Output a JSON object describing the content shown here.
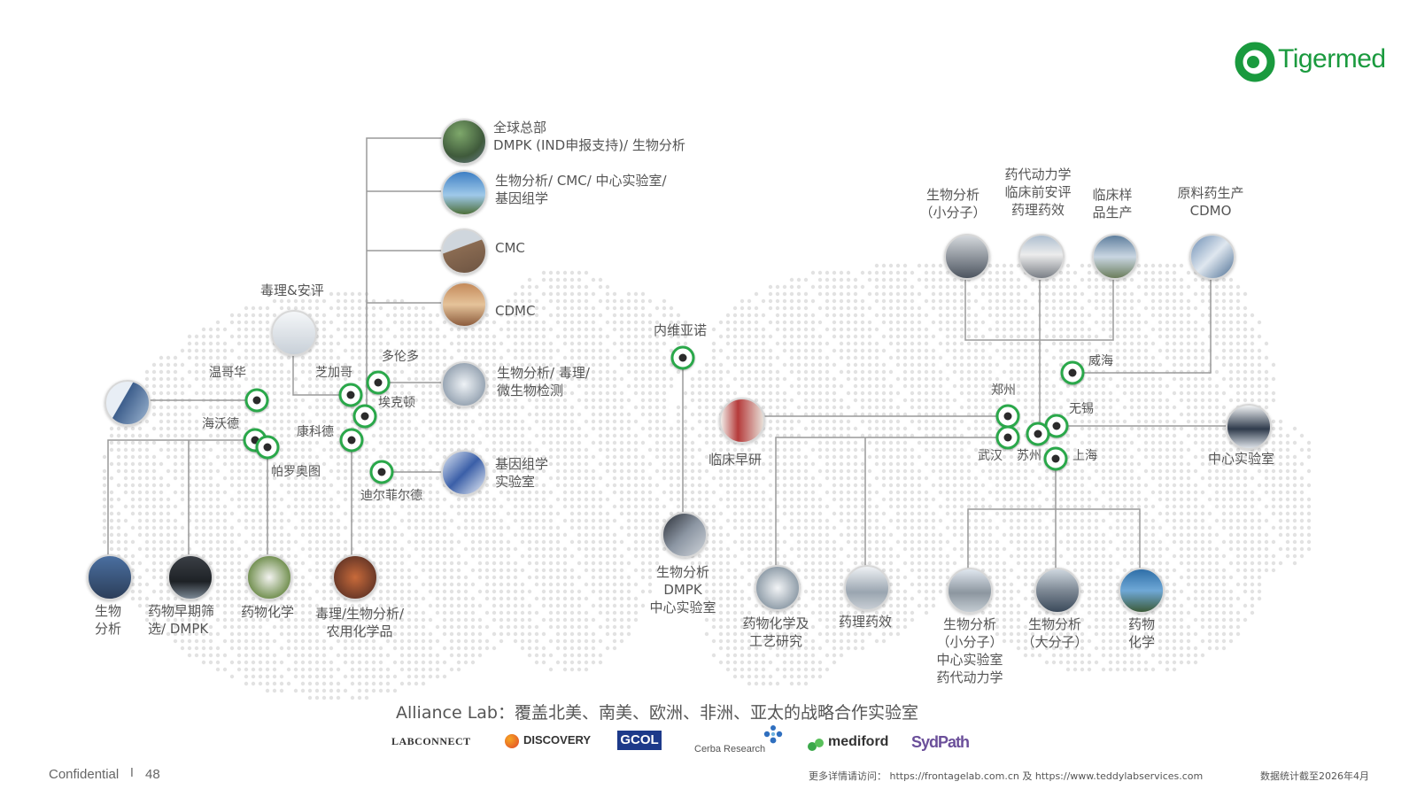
{
  "brand": {
    "name": "Tigermed",
    "color": "#1a9a3e"
  },
  "colors": {
    "node_ring": "#2aa84a",
    "line": "#9a9a9a",
    "dots": "#e2e2e2"
  },
  "north_america": {
    "hq_label": "全球总部",
    "hq_sub": "DMPK (IND申报支持)/ 生物分析",
    "site2": "生物分析/ CMC/ 中心实验室/",
    "site2b": "基因组学",
    "site3": "CMC",
    "site4": "CDMC",
    "site5": "生物分析/ 毒理/",
    "site5b": "微生物检测",
    "site6": "基因组学",
    "site6b": "实验室",
    "tox": "毒理&安评",
    "cities": {
      "vancouver": "温哥华",
      "chicago": "芝加哥",
      "toronto": "多伦多",
      "exton": "埃克顿",
      "hayward": "海沃德",
      "palo_alto": "帕罗奥图",
      "concord": "康科德",
      "deerfield": "迪尔菲尔德"
    },
    "bottom": [
      {
        "l1": "生物",
        "l2": "分析"
      },
      {
        "l1": "药物早期筛",
        "l2": "选/ DMPK"
      },
      {
        "l1": "药物化学",
        "l2": ""
      },
      {
        "l1": "毒理/生物分析/",
        "l2": "农用化学品"
      }
    ]
  },
  "europe": {
    "city": "内维亚诺",
    "site": {
      "l1": "生物分析",
      "l2": "DMPK",
      "l3": "中心实验室"
    }
  },
  "china": {
    "top": [
      {
        "l1": "生物分析",
        "l2": "（小分子）"
      },
      {
        "l1": "药代动力学",
        "l2": "临床前安评",
        "l3": "药理药效"
      },
      {
        "l1": "临床样",
        "l2": "品生产"
      },
      {
        "l1": "原料药生产",
        "l2": "CDMO"
      }
    ],
    "cities": {
      "weihai": "威海",
      "zhengzhou": "郑州",
      "wuxi": "无锡",
      "wuhan": "武汉",
      "suzhou": "苏州",
      "shanghai": "上海"
    },
    "early": "临床早研",
    "central_lab": "中心实验室",
    "bottom": [
      {
        "l1": "药物化学及",
        "l2": "工艺研究"
      },
      {
        "l1": "药理药效",
        "l2": ""
      },
      {
        "l1": "生物分析",
        "l2": "（小分子）",
        "l3": "中心实验室",
        "l4": "药代动力学"
      },
      {
        "l1": "生物分析",
        "l2": "（大分子）"
      },
      {
        "l1": "药物",
        "l2": "化学"
      }
    ]
  },
  "alliance": "Alliance Lab：覆盖北美、南美、欧洲、非洲、亚太的战略合作实验室",
  "partners": [
    "LABCONNECT",
    "DISCOVERY",
    "GCOL",
    "Cerba Research",
    "mediford",
    "SydPath"
  ],
  "footer": {
    "confidential": "Confidential",
    "sep": "I",
    "page": "48",
    "more_info": "更多详情请访问：  https://frontagelab.com.cn 及 https://www.teddylabservices.com",
    "date_note": "数据统计截至2026年4月"
  }
}
